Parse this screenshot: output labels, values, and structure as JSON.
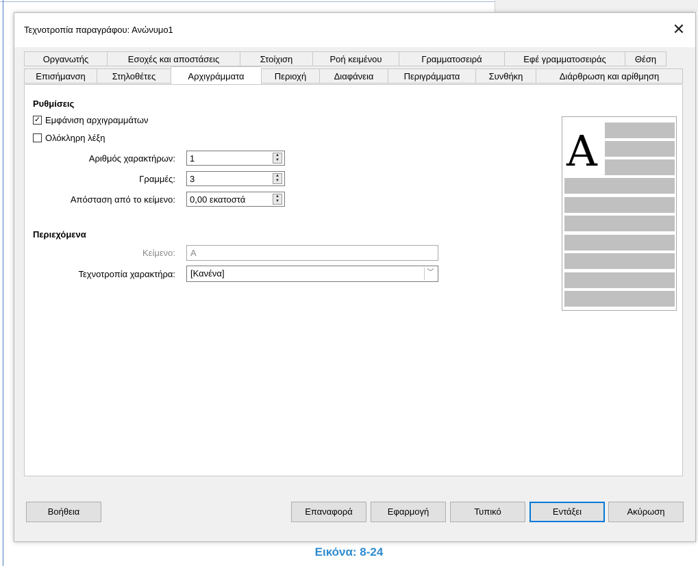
{
  "dialog": {
    "title": "Τεχνοτροπία παραγράφου: Ανώνυμο1",
    "close_symbol": "✕"
  },
  "tabs": {
    "row1": [
      "Οργανωτής",
      "Εσοχές και αποστάσεις",
      "Στοίχιση",
      "Ροή κειμένου",
      "Γραμματοσειρά",
      "Εφέ γραμματοσειράς",
      "Θέση"
    ],
    "row2": [
      "Επισήμανση",
      "Στηλοθέτες",
      "Αρχιγράμματα",
      "Περιοχή",
      "Διαφάνεια",
      "Περιγράμματα",
      "Συνθήκη",
      "Διάρθρωση και αρίθμηση"
    ],
    "active": "Αρχιγράμματα"
  },
  "settings": {
    "heading": "Ρυθμίσεις",
    "show_dropcaps": {
      "label": "Εμφάνιση αρχιγραμμάτων",
      "checked": true,
      "mark": "✓"
    },
    "whole_word": {
      "label": "Ολόκληρη λέξη",
      "checked": false
    },
    "num_chars": {
      "label": "Αριθμός χαρακτήρων:",
      "value": "1"
    },
    "lines": {
      "label": "Γραμμές:",
      "value": "3"
    },
    "spacing": {
      "label": "Απόσταση από το κείμενο:",
      "value": "0,00 εκατοστά"
    }
  },
  "contents": {
    "heading": "Περιεχόμενα",
    "text": {
      "label": "Κείμενο:",
      "value": "A"
    },
    "char_style": {
      "label": "Τεχνοτροπία χαρακτήρα:",
      "value": "[Κανένα]"
    }
  },
  "preview": {
    "letter": "A",
    "bar_color": "#c0c0c0"
  },
  "buttons": {
    "help": "Βοήθεια",
    "reset": "Επαναφορά",
    "apply": "Εφαρμογή",
    "standard": "Τυπικό",
    "ok": "Εντάξει",
    "cancel": "Ακύρωση"
  },
  "caption": "Εικόνα: 8-24",
  "colors": {
    "accent": "#0078d7",
    "caption": "#2e8bcf"
  }
}
